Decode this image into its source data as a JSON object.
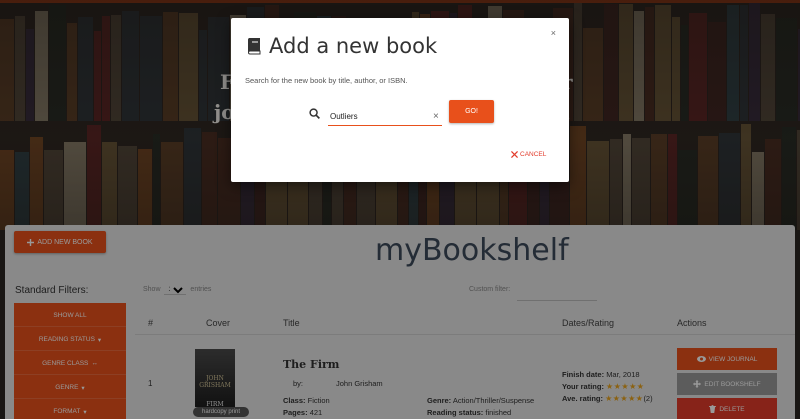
{
  "colors": {
    "accent": "#e8501b",
    "danger": "#e23b2b",
    "title": "#3d4a5a"
  },
  "hero": {
    "line1_left": "F",
    "line2_left": "jo",
    "line1_right": "r",
    "line2_right": "l"
  },
  "toolbar": {
    "add_label": "ADD NEW BOOK",
    "add_icon": "plus-icon"
  },
  "app_title": "myBookshelf",
  "filters": {
    "label": "Standard Filters:",
    "items": [
      {
        "label": "SHOW ALL",
        "icon": ""
      },
      {
        "label": "READING STATUS",
        "icon": "caret-down-icon"
      },
      {
        "label": "GENRE CLASS",
        "icon": "dots-icon"
      },
      {
        "label": "GENRE",
        "icon": "caret-down-icon"
      },
      {
        "label": "FORMAT",
        "icon": "caret-down-icon"
      }
    ]
  },
  "table_controls": {
    "show_label": "Show",
    "entries_value": "10",
    "entries_label": "entries",
    "custom_filter_label": "Custom filter:"
  },
  "table": {
    "headers": {
      "num": "#",
      "cover": "Cover",
      "title": "Title",
      "dates": "Dates/Rating",
      "actions": "Actions"
    },
    "rows": [
      {
        "index": "1",
        "cover_text_top": "JOHN GRISHAM",
        "cover_text_bottom": "FIRM",
        "format_badge": "hardcopy print",
        "title": "The Firm",
        "by_label": "by:",
        "author": "John Grisham",
        "class_label": "Class:",
        "class_value": "Fiction",
        "pages_label": "Pages:",
        "pages_value": "421",
        "genre_label": "Genre:",
        "genre_value": "Action/Thriller/Suspense",
        "status_label": "Reading status:",
        "status_value": "finished",
        "finish_label": "Finish date:",
        "finish_value": "Mar, 2018",
        "your_rating_label": "Your rating:",
        "your_rating_stars": "★★★★★",
        "ave_rating_label": "Ave. rating:",
        "ave_rating_stars": "★★★★★",
        "ave_rating_count": "(2)",
        "actions": {
          "view": "VIEW JOURNAL",
          "edit": "EDIT BOOKSHELF",
          "delete": "DELETE"
        }
      }
    ]
  },
  "modal": {
    "title": "Add a new book",
    "title_icon": "book-icon",
    "close": "×",
    "description": "Search for the new book by title, author, or ISBN.",
    "search_value": "Outliers",
    "clear": "×",
    "go_label": "GO!",
    "cancel_label": "CANCEL"
  }
}
